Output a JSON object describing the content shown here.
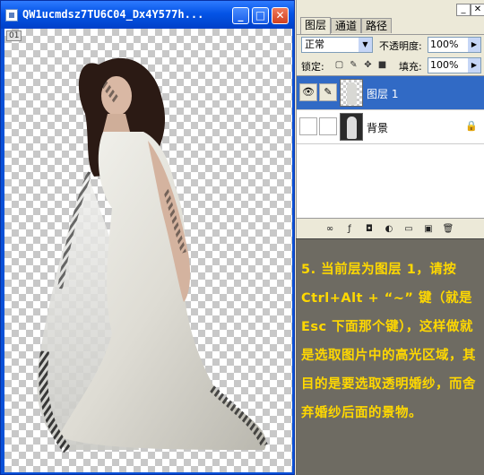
{
  "document": {
    "title": "QW1ucmdsz7TU6C04_Dx4Y577h...",
    "zoom_tag": "01",
    "buttons": {
      "minimize": "_",
      "maximize": "□",
      "close": "✕"
    }
  },
  "layers_panel": {
    "tabs": [
      "图层",
      "通道",
      "路径"
    ],
    "blend_mode": "正常",
    "opacity_label": "不透明度:",
    "opacity_value": "100%",
    "lock_label": "锁定:",
    "fill_label": "填充:",
    "fill_value": "100%",
    "layers": [
      {
        "name": "图层 1",
        "selected": true,
        "visible": true,
        "locked": false
      },
      {
        "name": "背景",
        "selected": false,
        "visible": false,
        "locked": true
      }
    ]
  },
  "instruction": {
    "text": "5. 当前层为图层 1，请按 Ctrl+Alt + “~” 键（就是 Esc 下面那个键），这样做就是选取图片中的高光区域，其目的是要选取透明婚纱，而舍弃婚纱后面的景物。"
  },
  "colors": {
    "title_blue": "#0454e6",
    "selection_blue": "#316ac5",
    "note_bg": "#6e6b62",
    "note_text": "#ffd800"
  }
}
